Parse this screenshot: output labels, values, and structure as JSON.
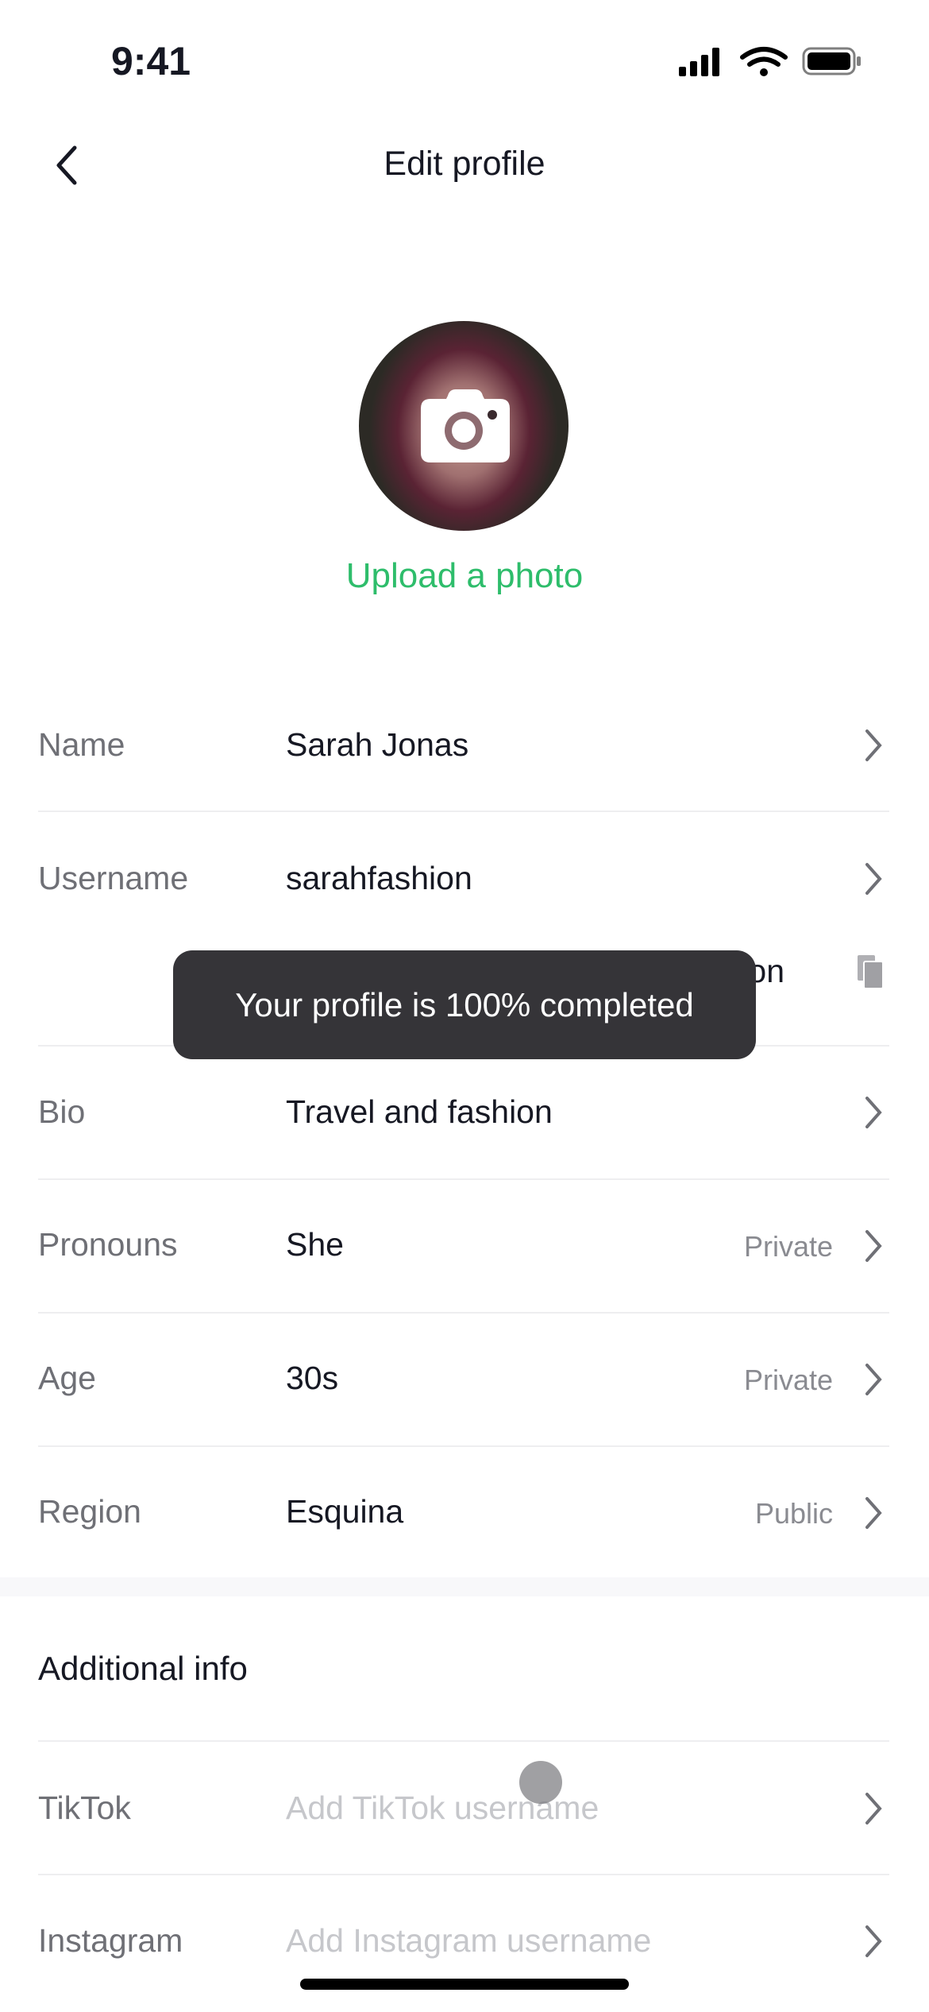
{
  "status_bar": {
    "time": "9:41"
  },
  "header": {
    "title": "Edit profile"
  },
  "avatar": {
    "upload_label": "Upload a photo"
  },
  "accent_color": "#2ebd6b",
  "fields": [
    {
      "label": "Name",
      "value": "Sarah Jonas"
    },
    {
      "label": "Username",
      "value": "sarahfashion",
      "secondary_fragment": "on"
    },
    {
      "label": "Bio",
      "value": "Travel and fashion"
    },
    {
      "label": "Pronouns",
      "value": "She",
      "visibility": "Private"
    },
    {
      "label": "Age",
      "value": "30s",
      "visibility": "Private"
    },
    {
      "label": "Region",
      "value": "Esquina",
      "visibility": "Public"
    }
  ],
  "additional": {
    "title": "Additional info",
    "items": [
      {
        "label": "TikTok",
        "placeholder": "Add TikTok username"
      },
      {
        "label": "Instagram",
        "placeholder": "Add Instagram username"
      }
    ]
  },
  "toast": {
    "message": "Your profile is 100% completed"
  }
}
